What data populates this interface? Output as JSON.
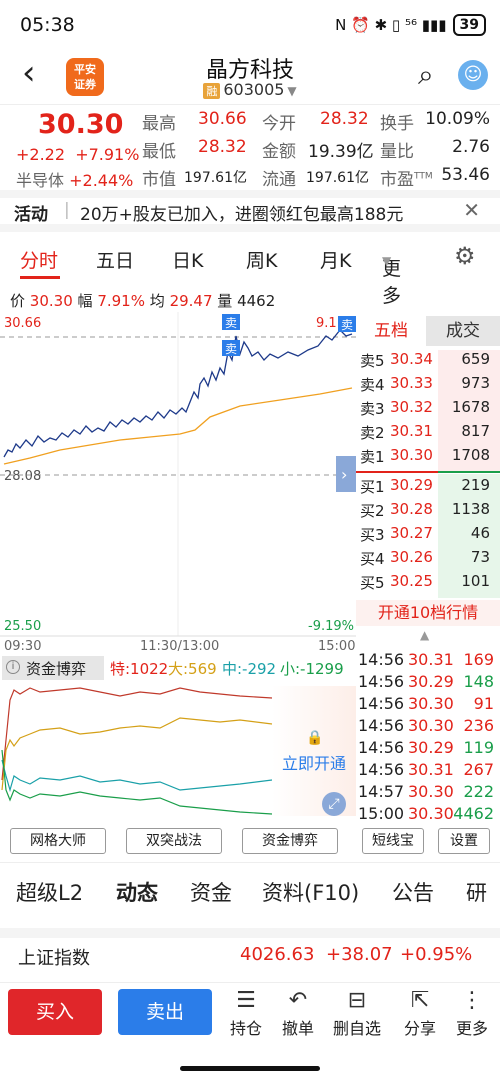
{
  "status_bar": {
    "time": "05:38",
    "icons": "N ⏰ ✱ ▯ ⁵⁶ ▮▮▮",
    "battery": "39"
  },
  "header": {
    "back_label": "‹",
    "logo_text": "平安\n证券",
    "name": "晶方科技",
    "rong_badge": "融",
    "code": "603005",
    "search_label": "⌕",
    "assistant_label": "☺"
  },
  "quote": {
    "price": "30.30",
    "change": "+2.22",
    "change_pct": "+7.91%",
    "sector": "半导体",
    "sector_pct": "+2.44%",
    "labels": {
      "high": "最高",
      "open": "今开",
      "turnover": "换手",
      "low": "最低",
      "amount": "金额",
      "volume_ratio": "量比",
      "mktcap": "市值",
      "float": "流通",
      "pe": "市盈"
    },
    "values": {
      "high": "30.66",
      "open": "28.32",
      "turnover": "10.09%",
      "low": "28.32",
      "amount": "19.39亿",
      "volume_ratio": "2.76",
      "mktcap": "197.61亿",
      "float": "197.61亿",
      "pe": "53.46"
    },
    "pe_sup": "TTM"
  },
  "activity": {
    "label": "活动",
    "text": "20万+股友已加入，进圈领红包最高188元",
    "close": "✕"
  },
  "chart_tabs": [
    "分时",
    "五日",
    "日K",
    "周K",
    "月K",
    "更多"
  ],
  "settings_label": "⚙",
  "price_info": {
    "price_label": "价",
    "price": "30.30",
    "amp_label": "幅",
    "amp": "7.91%",
    "avg_label": "均",
    "avg": "29.47",
    "vol_label": "量",
    "vol": "4462"
  },
  "chart_labels": {
    "top_price": "30.66",
    "top_pct": "9.1",
    "mid_price": "28.08",
    "bottom_price": "25.50",
    "bottom_pct": "-9.19%",
    "x_left": "09:30",
    "x_mid": "11:30/13:00",
    "x_right": "15:00",
    "sell_marker": "卖",
    "expand": "›"
  },
  "order_book": {
    "tab_active": "五档",
    "tab_other": "成交",
    "asks": [
      {
        "label": "卖5",
        "price": "30.34",
        "qty": "659"
      },
      {
        "label": "卖4",
        "price": "30.33",
        "qty": "973"
      },
      {
        "label": "卖3",
        "price": "30.32",
        "qty": "1678"
      },
      {
        "label": "卖2",
        "price": "30.31",
        "qty": "817"
      },
      {
        "label": "卖1",
        "price": "30.30",
        "qty": "1708"
      }
    ],
    "bids": [
      {
        "label": "买1",
        "price": "30.29",
        "qty": "219"
      },
      {
        "label": "买2",
        "price": "30.28",
        "qty": "1138"
      },
      {
        "label": "买3",
        "price": "30.27",
        "qty": "46"
      },
      {
        "label": "买4",
        "price": "30.26",
        "qty": "73"
      },
      {
        "label": "买5",
        "price": "30.25",
        "qty": "101"
      }
    ],
    "open_l2": "开通10档行情"
  },
  "fund_flow": {
    "info_icon": "i",
    "title": "资金博弈",
    "te": "特:1022",
    "da": "大:569",
    "zhong": "中:-292",
    "xiao": "小:-1299",
    "unlock": "立即开通",
    "lock_icon": "🔒"
  },
  "trades": [
    {
      "time": "14:56",
      "price": "30.31",
      "qty": "169",
      "dir": "up"
    },
    {
      "time": "14:56",
      "price": "30.29",
      "qty": "148",
      "dir": "down"
    },
    {
      "time": "14:56",
      "price": "30.30",
      "qty": "91",
      "dir": "up"
    },
    {
      "time": "14:56",
      "price": "30.30",
      "qty": "236",
      "dir": "up"
    },
    {
      "time": "14:56",
      "price": "30.29",
      "qty": "119",
      "dir": "down"
    },
    {
      "time": "14:56",
      "price": "30.31",
      "qty": "267",
      "dir": "up"
    },
    {
      "time": "14:57",
      "price": "30.30",
      "qty": "222",
      "dir": "down"
    },
    {
      "time": "15:00",
      "price": "30.30",
      "qty": "4462",
      "dir": "down"
    }
  ],
  "tool_buttons": [
    "网格大师",
    "双突战法",
    "资金博弈",
    "短线宝",
    "设置"
  ],
  "bottom_tabs": [
    "超级L2",
    "动态",
    "资金",
    "资料(F10)",
    "公告",
    "研"
  ],
  "index": {
    "name": "上证指数",
    "value": "4026.63",
    "change": "+38.07",
    "pct": "+0.95%"
  },
  "action_bar": {
    "buy": "买入",
    "sell": "卖出",
    "items": [
      {
        "icon": "☰",
        "label": "持仓"
      },
      {
        "icon": "↶",
        "label": "撤单"
      },
      {
        "icon": "⊟",
        "label": "删自选"
      },
      {
        "icon": "⇱",
        "label": "分享"
      },
      {
        "icon": "⋮",
        "label": "更多"
      }
    ]
  },
  "colors": {
    "red": "#e2231a",
    "green": "#1a9e4a",
    "blue": "#1e3a8a",
    "orange": "#f0a020",
    "buy": "#e0262a",
    "sell": "#2b7de9"
  }
}
